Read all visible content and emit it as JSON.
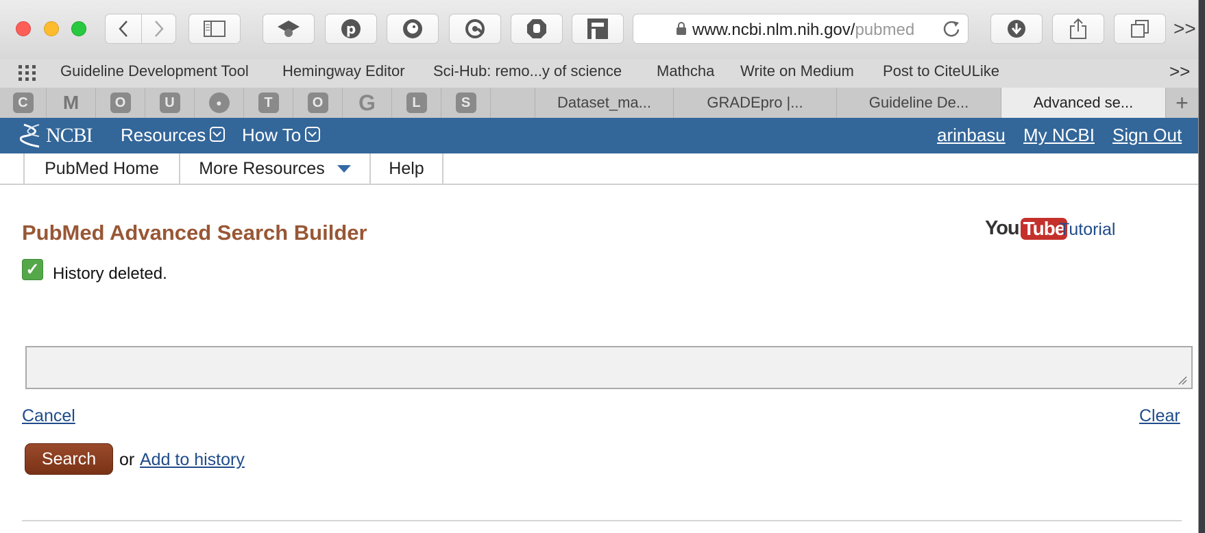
{
  "browser": {
    "address": {
      "host": "www.ncbi.nlm.nih.gov/",
      "path_fade": "pubmed"
    },
    "toolbar_overflow": ">>",
    "bookmarks": [
      "Guideline Development Tool",
      "Hemingway Editor",
      "Sci-Hub: remo...y of science",
      "Mathcha",
      "Write on Medium",
      "Post to CiteULike"
    ],
    "bookmarks_overflow": ">>",
    "pinned_tabs": [
      "C",
      "M",
      "O",
      "U",
      "●",
      "T",
      "O",
      "G",
      "L",
      "S"
    ],
    "tabs": [
      "Dataset_ma...",
      "GRADEpro |...",
      "Guideline De...",
      "Advanced se..."
    ],
    "new_tab": "+"
  },
  "ncbi_header": {
    "logo": "NCBI",
    "resources": "Resources",
    "how_to": "How To",
    "user": "arinbasu",
    "my_ncbi": "My NCBI",
    "sign_out": "Sign Out"
  },
  "subnav": {
    "home": "PubMed Home",
    "more": "More Resources",
    "help": "Help"
  },
  "main": {
    "title": "PubMed Advanced Search Builder",
    "youtube_you": "You",
    "youtube_tube": "Tube",
    "tutorial": "Tutorial",
    "status_message": "History deleted.",
    "query_value": "",
    "cancel": "Cancel",
    "clear": "Clear",
    "search": "Search",
    "or": "or",
    "add_to_history": "Add to history"
  },
  "colors": {
    "ncbi_blue": "#336699",
    "title_brown": "#985735",
    "link_blue": "#1f4b8a",
    "search_button": "#8a3d1f"
  }
}
